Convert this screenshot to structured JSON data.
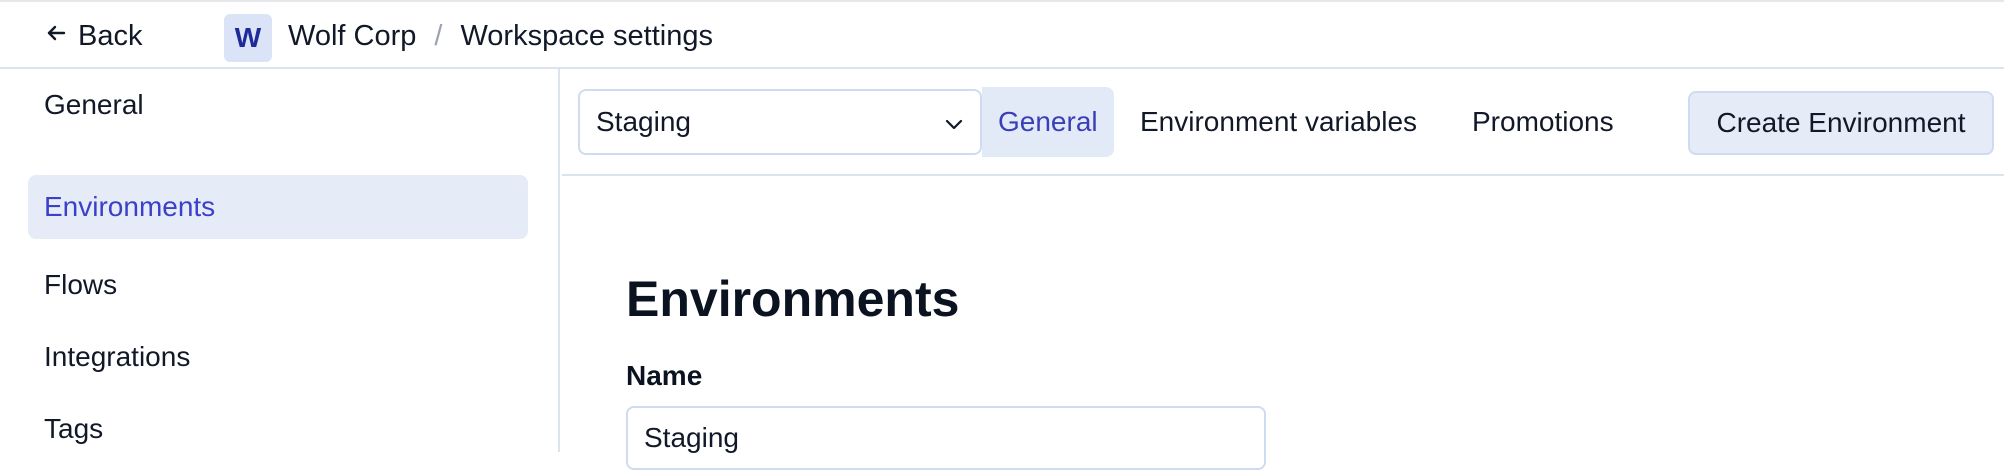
{
  "topbar": {
    "back_label": "Back",
    "workspace_initial": "W",
    "breadcrumb": {
      "org": "Wolf Corp",
      "separator": "/",
      "page": "Workspace settings"
    }
  },
  "sidebar": {
    "items": [
      {
        "label": "General",
        "active": false
      },
      {
        "label": "Environments",
        "active": true
      },
      {
        "label": "Flows",
        "active": false
      },
      {
        "label": "Integrations",
        "active": false
      },
      {
        "label": "Tags",
        "active": false
      }
    ]
  },
  "toolbar": {
    "environment_select": {
      "value": "Staging"
    },
    "tabs": [
      {
        "label": "General",
        "active": true
      },
      {
        "label": "Environment variables",
        "active": false
      },
      {
        "label": "Promotions",
        "active": false
      }
    ],
    "create_button_label": "Create Environment"
  },
  "main": {
    "title": "Environments",
    "name_field": {
      "label": "Name",
      "value": "Staging"
    }
  },
  "colors": {
    "accent": "#3b3fc9",
    "active_bg": "#e5ecf7",
    "border": "#dbe3ef"
  },
  "icons": {
    "back": "arrow-left-icon",
    "select": "chevron-down-icon"
  }
}
